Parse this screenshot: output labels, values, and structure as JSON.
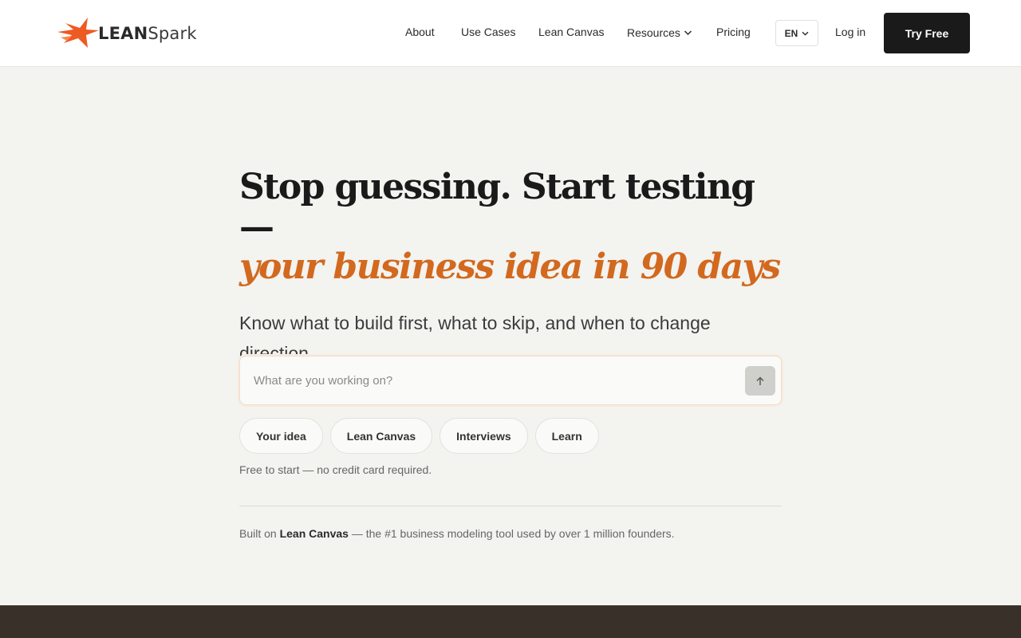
{
  "brand": {
    "name_bold": "LEAN",
    "name_rest": "Spark",
    "colors": {
      "accent": "#d2691e",
      "logo_orange": "#ee5a24"
    }
  },
  "nav": {
    "about": "About",
    "use_cases": "Use Cases",
    "lean_canvas": "Lean Canvas",
    "resources": "Resources",
    "pricing": "Pricing",
    "language": "EN",
    "login": "Log in",
    "cta": "Try Free"
  },
  "hero": {
    "headline": "Stop guessing. Start testing—",
    "headline_accent": "your business idea in 90 days",
    "subheadline": "Know what to build first, what to skip, and when to change direction."
  },
  "prompt": {
    "placeholder": "What are you working on?",
    "value": "",
    "send_icon": "arrow-up-icon"
  },
  "chips": [
    "Your idea",
    "Lean Canvas",
    "Interviews",
    "Learn"
  ],
  "note": "Free to start — no credit card required.",
  "built_on": {
    "prefix": "Built on ",
    "highlight": "Lean Canvas",
    "suffix": " — the #1 business modeling tool used by over 1 million founders."
  }
}
